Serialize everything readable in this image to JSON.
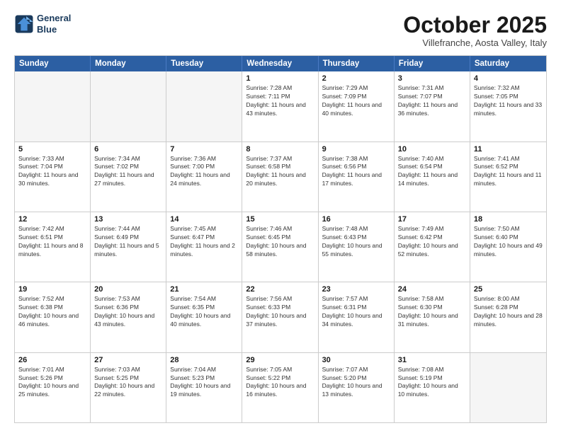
{
  "logo": {
    "line1": "General",
    "line2": "Blue"
  },
  "title": "October 2025",
  "subtitle": "Villefranche, Aosta Valley, Italy",
  "days": [
    "Sunday",
    "Monday",
    "Tuesday",
    "Wednesday",
    "Thursday",
    "Friday",
    "Saturday"
  ],
  "weeks": [
    [
      {
        "day": "",
        "empty": true
      },
      {
        "day": "",
        "empty": true
      },
      {
        "day": "",
        "empty": true
      },
      {
        "day": "1",
        "sunrise": "Sunrise: 7:28 AM",
        "sunset": "Sunset: 7:11 PM",
        "daylight": "Daylight: 11 hours and 43 minutes."
      },
      {
        "day": "2",
        "sunrise": "Sunrise: 7:29 AM",
        "sunset": "Sunset: 7:09 PM",
        "daylight": "Daylight: 11 hours and 40 minutes."
      },
      {
        "day": "3",
        "sunrise": "Sunrise: 7:31 AM",
        "sunset": "Sunset: 7:07 PM",
        "daylight": "Daylight: 11 hours and 36 minutes."
      },
      {
        "day": "4",
        "sunrise": "Sunrise: 7:32 AM",
        "sunset": "Sunset: 7:05 PM",
        "daylight": "Daylight: 11 hours and 33 minutes."
      }
    ],
    [
      {
        "day": "5",
        "sunrise": "Sunrise: 7:33 AM",
        "sunset": "Sunset: 7:04 PM",
        "daylight": "Daylight: 11 hours and 30 minutes."
      },
      {
        "day": "6",
        "sunrise": "Sunrise: 7:34 AM",
        "sunset": "Sunset: 7:02 PM",
        "daylight": "Daylight: 11 hours and 27 minutes."
      },
      {
        "day": "7",
        "sunrise": "Sunrise: 7:36 AM",
        "sunset": "Sunset: 7:00 PM",
        "daylight": "Daylight: 11 hours and 24 minutes."
      },
      {
        "day": "8",
        "sunrise": "Sunrise: 7:37 AM",
        "sunset": "Sunset: 6:58 PM",
        "daylight": "Daylight: 11 hours and 20 minutes."
      },
      {
        "day": "9",
        "sunrise": "Sunrise: 7:38 AM",
        "sunset": "Sunset: 6:56 PM",
        "daylight": "Daylight: 11 hours and 17 minutes."
      },
      {
        "day": "10",
        "sunrise": "Sunrise: 7:40 AM",
        "sunset": "Sunset: 6:54 PM",
        "daylight": "Daylight: 11 hours and 14 minutes."
      },
      {
        "day": "11",
        "sunrise": "Sunrise: 7:41 AM",
        "sunset": "Sunset: 6:52 PM",
        "daylight": "Daylight: 11 hours and 11 minutes."
      }
    ],
    [
      {
        "day": "12",
        "sunrise": "Sunrise: 7:42 AM",
        "sunset": "Sunset: 6:51 PM",
        "daylight": "Daylight: 11 hours and 8 minutes."
      },
      {
        "day": "13",
        "sunrise": "Sunrise: 7:44 AM",
        "sunset": "Sunset: 6:49 PM",
        "daylight": "Daylight: 11 hours and 5 minutes."
      },
      {
        "day": "14",
        "sunrise": "Sunrise: 7:45 AM",
        "sunset": "Sunset: 6:47 PM",
        "daylight": "Daylight: 11 hours and 2 minutes."
      },
      {
        "day": "15",
        "sunrise": "Sunrise: 7:46 AM",
        "sunset": "Sunset: 6:45 PM",
        "daylight": "Daylight: 10 hours and 58 minutes."
      },
      {
        "day": "16",
        "sunrise": "Sunrise: 7:48 AM",
        "sunset": "Sunset: 6:43 PM",
        "daylight": "Daylight: 10 hours and 55 minutes."
      },
      {
        "day": "17",
        "sunrise": "Sunrise: 7:49 AM",
        "sunset": "Sunset: 6:42 PM",
        "daylight": "Daylight: 10 hours and 52 minutes."
      },
      {
        "day": "18",
        "sunrise": "Sunrise: 7:50 AM",
        "sunset": "Sunset: 6:40 PM",
        "daylight": "Daylight: 10 hours and 49 minutes."
      }
    ],
    [
      {
        "day": "19",
        "sunrise": "Sunrise: 7:52 AM",
        "sunset": "Sunset: 6:38 PM",
        "daylight": "Daylight: 10 hours and 46 minutes."
      },
      {
        "day": "20",
        "sunrise": "Sunrise: 7:53 AM",
        "sunset": "Sunset: 6:36 PM",
        "daylight": "Daylight: 10 hours and 43 minutes."
      },
      {
        "day": "21",
        "sunrise": "Sunrise: 7:54 AM",
        "sunset": "Sunset: 6:35 PM",
        "daylight": "Daylight: 10 hours and 40 minutes."
      },
      {
        "day": "22",
        "sunrise": "Sunrise: 7:56 AM",
        "sunset": "Sunset: 6:33 PM",
        "daylight": "Daylight: 10 hours and 37 minutes."
      },
      {
        "day": "23",
        "sunrise": "Sunrise: 7:57 AM",
        "sunset": "Sunset: 6:31 PM",
        "daylight": "Daylight: 10 hours and 34 minutes."
      },
      {
        "day": "24",
        "sunrise": "Sunrise: 7:58 AM",
        "sunset": "Sunset: 6:30 PM",
        "daylight": "Daylight: 10 hours and 31 minutes."
      },
      {
        "day": "25",
        "sunrise": "Sunrise: 8:00 AM",
        "sunset": "Sunset: 6:28 PM",
        "daylight": "Daylight: 10 hours and 28 minutes."
      }
    ],
    [
      {
        "day": "26",
        "sunrise": "Sunrise: 7:01 AM",
        "sunset": "Sunset: 5:26 PM",
        "daylight": "Daylight: 10 hours and 25 minutes."
      },
      {
        "day": "27",
        "sunrise": "Sunrise: 7:03 AM",
        "sunset": "Sunset: 5:25 PM",
        "daylight": "Daylight: 10 hours and 22 minutes."
      },
      {
        "day": "28",
        "sunrise": "Sunrise: 7:04 AM",
        "sunset": "Sunset: 5:23 PM",
        "daylight": "Daylight: 10 hours and 19 minutes."
      },
      {
        "day": "29",
        "sunrise": "Sunrise: 7:05 AM",
        "sunset": "Sunset: 5:22 PM",
        "daylight": "Daylight: 10 hours and 16 minutes."
      },
      {
        "day": "30",
        "sunrise": "Sunrise: 7:07 AM",
        "sunset": "Sunset: 5:20 PM",
        "daylight": "Daylight: 10 hours and 13 minutes."
      },
      {
        "day": "31",
        "sunrise": "Sunrise: 7:08 AM",
        "sunset": "Sunset: 5:19 PM",
        "daylight": "Daylight: 10 hours and 10 minutes."
      },
      {
        "day": "",
        "empty": true
      }
    ]
  ]
}
